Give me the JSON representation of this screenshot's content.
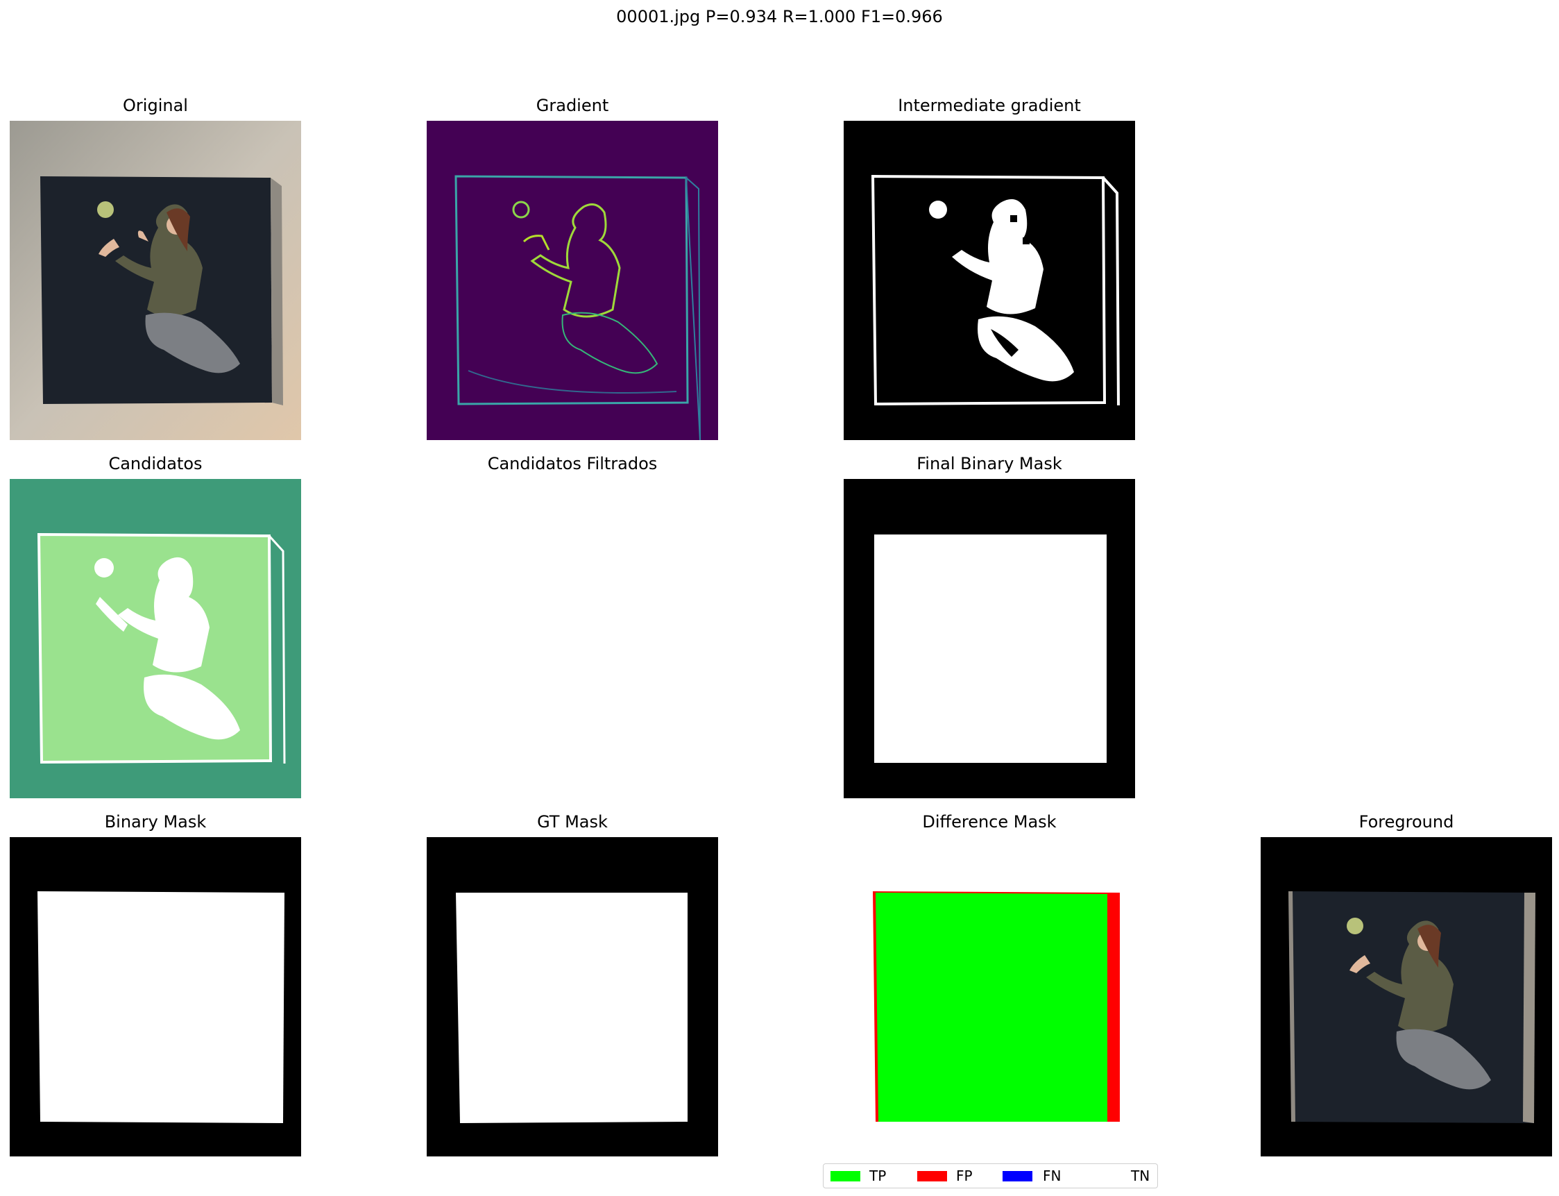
{
  "figure": {
    "suptitle": "00001.jpg  P=0.934 R=1.000 F1=0.966"
  },
  "panels": {
    "original": {
      "title": "Original"
    },
    "gradient": {
      "title": "Gradient"
    },
    "intermediate": {
      "title": "Intermediate gradient"
    },
    "candidatos": {
      "title": "Candidatos"
    },
    "candidatos_filtrados": {
      "title": "Candidatos Filtrados"
    },
    "final_mask": {
      "title": "Final Binary Mask"
    },
    "binary_mask": {
      "title": "Binary Mask"
    },
    "gt_mask": {
      "title": "GT Mask"
    },
    "difference_mask": {
      "title": "Difference Mask"
    },
    "foreground": {
      "title": "Foreground"
    }
  },
  "legend": {
    "items": [
      {
        "label": "TP",
        "color": "#00ff00"
      },
      {
        "label": "FP",
        "color": "#ff0000"
      },
      {
        "label": "FN",
        "color": "#0000ff"
      },
      {
        "label": "TN",
        "color": "#000000"
      }
    ]
  },
  "colors": {
    "gradient_bg": "#440154",
    "candidatos_bg": "#3e9b79",
    "candidatos_fill": "#9ae28e",
    "tp": "#00ff00",
    "fp": "#ff0000"
  }
}
